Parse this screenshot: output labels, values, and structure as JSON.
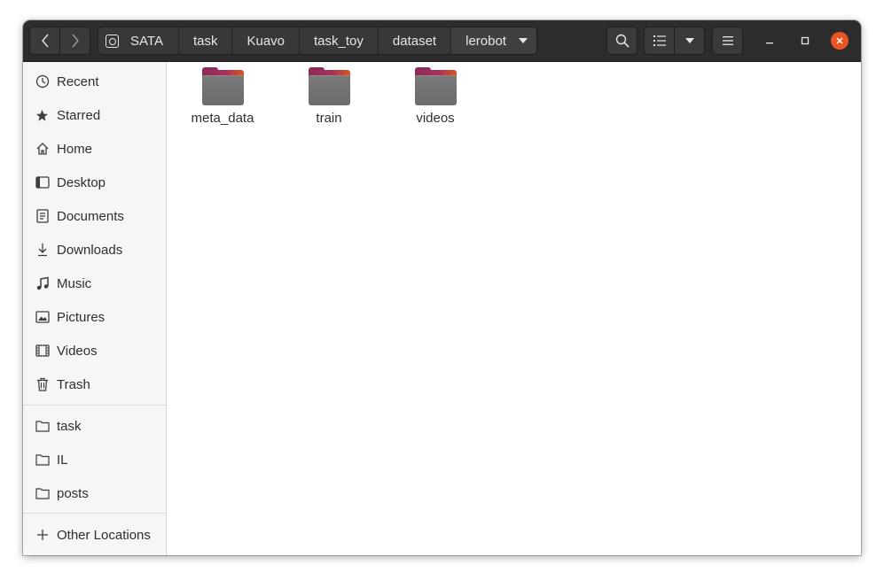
{
  "window": {
    "nav": {
      "back_icon": "chevron-left-icon",
      "forward_icon": "chevron-right-icon"
    },
    "pathbar": {
      "drive_icon": "drive-icon",
      "crumbs": [
        "SATA",
        "task",
        "Kuavo",
        "task_toy",
        "dataset",
        "lerobot"
      ]
    },
    "toolbar": {
      "search_icon": "search-icon",
      "list_view_icon": "list-view-icon",
      "view_options_icon": "chevron-down-icon",
      "menu_icon": "hamburger-menu-icon"
    },
    "controls": {
      "minimize_icon": "minimize-icon",
      "maximize_icon": "maximize-icon",
      "close_icon": "close-icon",
      "close_color": "#e95420"
    }
  },
  "sidebar": {
    "places": [
      {
        "label": "Recent",
        "icon": "clock-icon"
      },
      {
        "label": "Starred",
        "icon": "star-icon"
      },
      {
        "label": "Home",
        "icon": "home-icon"
      },
      {
        "label": "Desktop",
        "icon": "desktop-icon"
      },
      {
        "label": "Documents",
        "icon": "document-icon"
      },
      {
        "label": "Downloads",
        "icon": "download-icon"
      },
      {
        "label": "Music",
        "icon": "music-icon"
      },
      {
        "label": "Pictures",
        "icon": "picture-icon"
      },
      {
        "label": "Videos",
        "icon": "video-icon"
      },
      {
        "label": "Trash",
        "icon": "trash-icon"
      }
    ],
    "bookmarks": [
      {
        "label": "task",
        "icon": "folder-icon"
      },
      {
        "label": "IL",
        "icon": "folder-icon"
      },
      {
        "label": "posts",
        "icon": "folder-icon"
      }
    ],
    "other": {
      "label": "Other Locations",
      "icon": "plus-icon"
    }
  },
  "content": {
    "files": [
      {
        "name": "meta_data",
        "icon": "folder-icon"
      },
      {
        "name": "train",
        "icon": "folder-icon"
      },
      {
        "name": "videos",
        "icon": "folder-icon"
      }
    ]
  }
}
